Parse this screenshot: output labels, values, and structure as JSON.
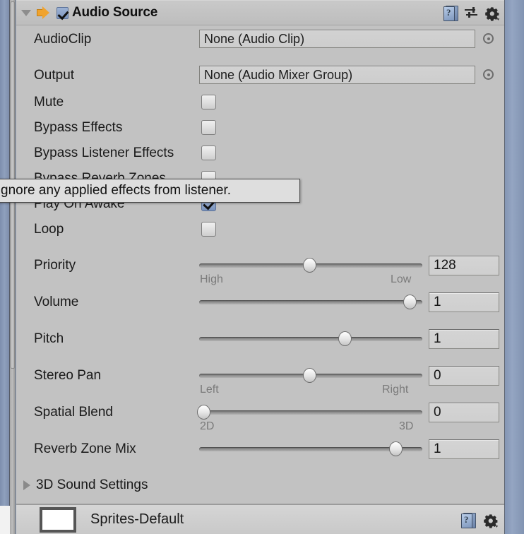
{
  "window": {
    "background_color": "#c2c2c2",
    "panel_edge_color": "#8fa0bd"
  },
  "component_header": {
    "foldout_state": "expanded",
    "icon": "audio-speaker-icon",
    "enabled": true,
    "title": "Audio Source",
    "icons": [
      "help-icon",
      "preset-icon",
      "gear-icon"
    ]
  },
  "fields": {
    "audio_clip": {
      "label": "AudioClip",
      "value": "None (Audio Clip)",
      "picker": "object-picker-icon"
    },
    "output": {
      "label": "Output",
      "value": "None (Audio Mixer Group)",
      "picker": "object-picker-icon"
    }
  },
  "toggles": [
    {
      "label": "Mute",
      "checked": false
    },
    {
      "label": "Bypass Effects",
      "checked": false
    },
    {
      "label": "Bypass Listener Effects",
      "checked": false
    },
    {
      "label": "Bypass Reverb Zones",
      "checked": false
    },
    {
      "label": "Play On Awake",
      "checked": true
    },
    {
      "label": "Loop",
      "checked": false
    }
  ],
  "sliders": [
    {
      "label": "Priority",
      "value": "128",
      "fill_percent": 50,
      "min_label": "High",
      "max_label": "Low"
    },
    {
      "label": "Volume",
      "value": "1",
      "fill_percent": 100,
      "min_label": "",
      "max_label": ""
    },
    {
      "label": "Pitch",
      "value": "1",
      "fill_percent": 65,
      "min_label": "",
      "max_label": ""
    },
    {
      "label": "Stereo Pan",
      "value": "0",
      "fill_percent": 50,
      "min_label": "Left",
      "max_label": "Right"
    },
    {
      "label": "Spatial Blend",
      "value": "0",
      "fill_percent": 0,
      "min_label": "2D",
      "max_label": "3D"
    },
    {
      "label": "Reverb Zone Mix",
      "value": "1",
      "fill_percent": 88,
      "min_label": "",
      "max_label": ""
    }
  ],
  "sound_settings_foldout": {
    "label": "3D Sound Settings",
    "state": "collapsed"
  },
  "material_strip": {
    "name": "Sprites-Default",
    "icons": [
      "help-icon",
      "gear-icon"
    ]
  },
  "tooltip": {
    "text": "gnore any applied effects from listener.",
    "full_text": "Ignore any applied effects from listener."
  }
}
